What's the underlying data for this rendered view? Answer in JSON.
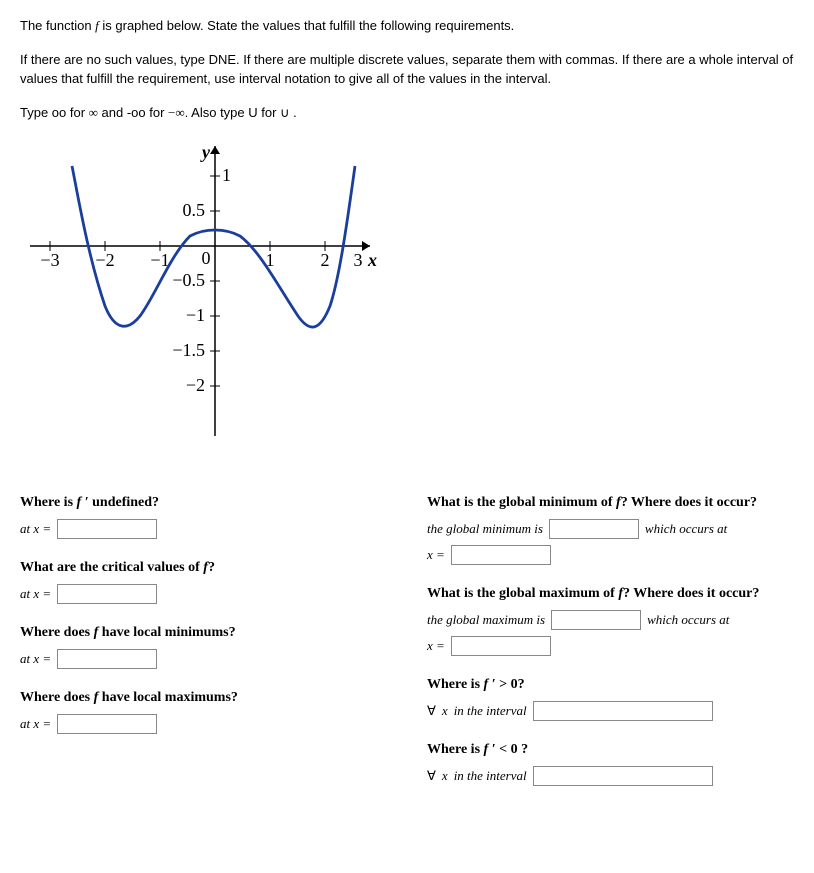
{
  "intro": {
    "p1": "The function f is graphed below. State the values that fulfill the following requirements.",
    "p2": "If there are no such values, type DNE. If there are multiple discrete values, separate them with commas. If there are a whole interval of values that fulfill the requirement, use interval notation to give all of the values in the interval.",
    "p3_a": "Type oo for ",
    "p3_inf": "∞",
    "p3_b": " and -oo for ",
    "p3_neginf": "−∞",
    "p3_c": ". Also type U for ",
    "p3_cup": "∪",
    "p3_d": " ."
  },
  "axis": {
    "x_ticks": [
      "−3",
      "−2",
      "−1",
      "0",
      "1",
      "2",
      "3"
    ],
    "y_ticks_pos": [
      "0.5",
      "1"
    ],
    "y_ticks_neg": [
      "−0.5",
      "−1",
      "−1.5",
      "−2"
    ],
    "x_label": "x",
    "y_label": "y"
  },
  "chart_data": {
    "type": "line",
    "title": "",
    "xlabel": "x",
    "ylabel": "y",
    "xlim": [
      -3,
      3
    ],
    "ylim": [
      -2,
      1
    ],
    "series": [
      {
        "name": "f",
        "x": [
          -2.6,
          -2.4,
          -2.2,
          -2.0,
          -1.8,
          -1.5,
          -1.2,
          -1.0,
          -0.7,
          -0.4,
          0.0,
          0.4,
          0.8,
          1.2,
          1.5,
          1.8,
          2.0,
          2.2,
          2.4,
          2.6
        ],
        "y": [
          1.0,
          0.2,
          -0.6,
          -1.0,
          -1.1,
          -1.1,
          -0.8,
          -0.5,
          0.0,
          0.15,
          0.2,
          0.15,
          -0.1,
          -0.6,
          -1.0,
          -1.1,
          -1.0,
          -0.5,
          0.3,
          1.0
        ]
      }
    ]
  },
  "q": {
    "undef_title_a": "Where is ",
    "undef_title_b": " undefined?",
    "crit_title_a": "What are the critical values of ",
    "crit_title_b": "?",
    "locmin_title_a": "Where does ",
    "locmin_title_b": " have local minimums?",
    "locmax_title_a": "Where does ",
    "locmax_title_b": " have local maximums?",
    "gmin_title_a": "What is the global minimum of ",
    "gmin_title_b": "? Where does it occur?",
    "gmin_line": "the global minimum is",
    "gmax_title_a": "What is the global maximum of ",
    "gmax_title_b": "? Where does it occur?",
    "gmax_line": "the global maximum is",
    "which": "which occurs at",
    "fprime_gt_a": "Where is ",
    "fprime_gt_b": " > 0?",
    "fprime_lt_a": "Where is ",
    "fprime_lt_b": " < 0 ?",
    "forall_line_a": "∀",
    "forall_line_b": " in the interval",
    "at_x": "at x =",
    "x_eq": "x =",
    "f": "f",
    "fprime": "f ′"
  }
}
